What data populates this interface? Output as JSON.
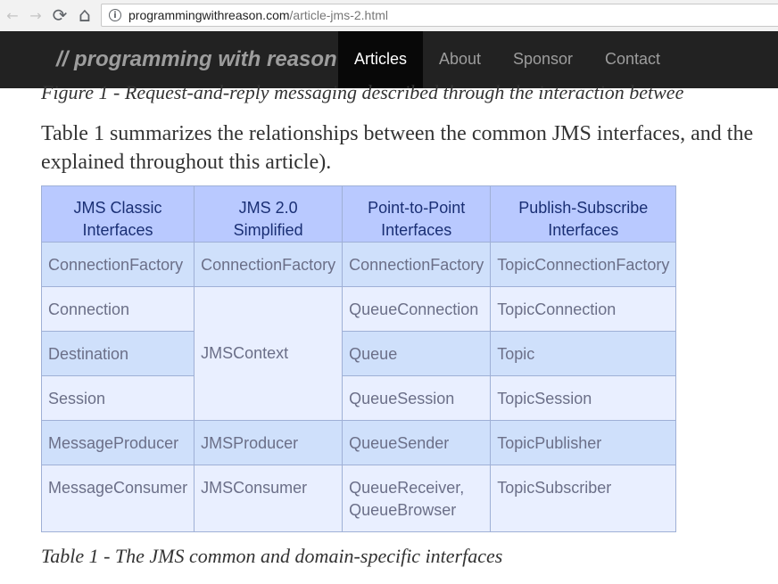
{
  "browser": {
    "back_glyph": "←",
    "forward_glyph": "→",
    "reload_glyph": "⟳",
    "home_glyph": "⌂",
    "info_glyph": "i",
    "url_host": "programmingwithreason.com",
    "url_path": "/article-jms-2.html"
  },
  "site": {
    "brand": "// programming with reason",
    "nav": [
      {
        "label": "Articles",
        "active": true
      },
      {
        "label": "About"
      },
      {
        "label": "Sponsor"
      },
      {
        "label": "Contact"
      }
    ]
  },
  "article": {
    "figure_caption": "Figure 1 - Request-and-reply messaging described through the interaction betwee",
    "paragraph_line1": "Table 1 summarizes the relationships between the common JMS interfaces, and the",
    "paragraph_line2": "explained throughout this article).",
    "table": {
      "headers": [
        [
          "JMS Classic",
          "Interfaces"
        ],
        [
          "JMS 2.0",
          "Simplified"
        ],
        [
          "Point-to-Point",
          "Interfaces"
        ],
        [
          "Publish-Subscribe",
          "Interfaces"
        ]
      ],
      "rows": [
        {
          "c0": "ConnectionFactory",
          "c1": "ConnectionFactory",
          "c2": "ConnectionFactory",
          "c3": "TopicConnectionFactory"
        },
        {
          "c0": "Connection",
          "c1": "JMSContext",
          "c2": "QueueConnection",
          "c3": "TopicConnection"
        },
        {
          "c0": "Destination",
          "c2": "Queue",
          "c3": "Topic"
        },
        {
          "c0": "Session",
          "c2": "QueueSession",
          "c3": "TopicSession"
        },
        {
          "c0": "MessageProducer",
          "c1": "JMSProducer",
          "c2": "QueueSender",
          "c3": "TopicPublisher"
        },
        {
          "c0": "MessageConsumer",
          "c1": "JMSConsumer",
          "c2a": "QueueReceiver,",
          "c2b": "QueueBrowser",
          "c3": "TopicSubscriber"
        }
      ]
    },
    "table_caption": "Table 1 - The JMS common and domain-specific interfaces"
  }
}
